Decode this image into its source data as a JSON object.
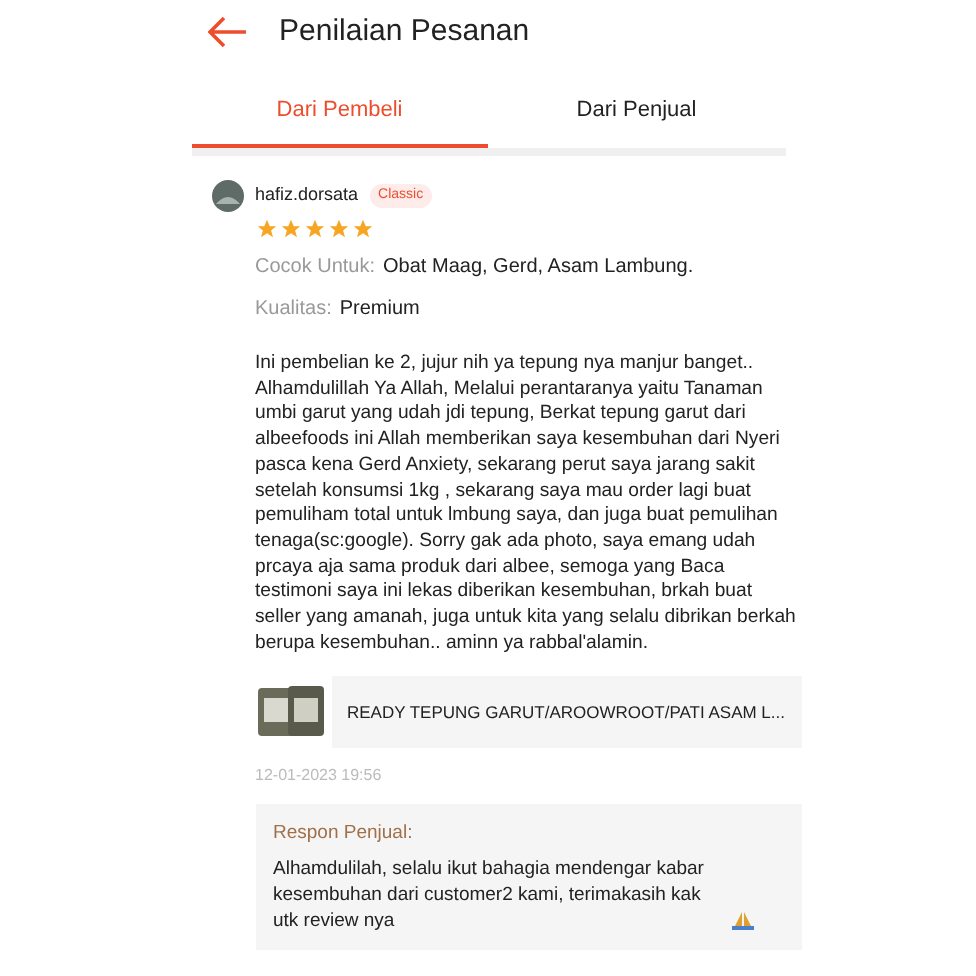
{
  "header": {
    "title": "Penilaian Pesanan"
  },
  "tabs": [
    {
      "label": "Dari Pembeli",
      "selected": true
    },
    {
      "label": "Dari Penjual",
      "selected": false
    }
  ],
  "review": {
    "username": "hafiz.dorsata",
    "badge": "Classic",
    "stars": 5,
    "fields": [
      {
        "label": "Cocok Untuk:",
        "value": "Obat Maag, Gerd, Asam Lambung."
      },
      {
        "label": "Kualitas:",
        "value": "Premium"
      }
    ],
    "text": "Ini pembelian ke 2, jujur nih ya tepung nya manjur banget.. Alhamdulillah Ya Allah, Melalui perantaranya yaitu Tanaman umbi garut yang udah jdi tepung, Berkat tepung garut dari albeefoods ini Allah memberikan saya kesembuhan dari Nyeri pasca kena Gerd Anxiety, sekarang perut saya jarang sakit setelah konsumsi 1kg , sekarang saya mau order lagi buat pemuliham total untuk lmbung saya, dan juga buat pemulihan tenaga(sc:google). Sorry gak ada photo, saya emang udah prcaya aja sama produk dari albee, semoga yang Baca testimoni saya ini lekas diberikan kesembuhan, brkah buat seller yang amanah, juga untuk kita yang selalu dibrikan berkah berupa kesembuhan.. aminn ya rabbal'alamin.",
    "product": {
      "name": "READY TEPUNG GARUT/AROOWROOT/PATI ASAM L..."
    },
    "date": "12-01-2023 19:56",
    "seller_response": {
      "label": "Respon Penjual:",
      "text": "Alhamdulilah, selalu ikut bahagia mendengar kabar kesembuhan dari customer2 kami, terimakasih kak utk review nya"
    }
  }
}
